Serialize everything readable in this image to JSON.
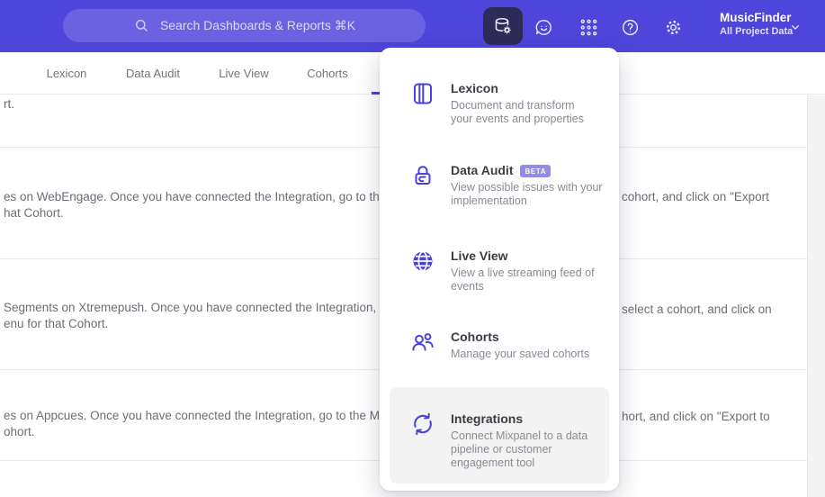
{
  "header": {
    "search_placeholder": "Search Dashboards & Reports ⌘K",
    "project_name": "MusicFinder",
    "project_scope": "All Project Data",
    "icon_names": [
      "data-management-icon",
      "feedback-icon",
      "apps-grid-icon",
      "help-icon",
      "settings-icon",
      "chevron-down-icon"
    ]
  },
  "tabs": {
    "items": [
      {
        "label": "Lexicon"
      },
      {
        "label": "Data Audit"
      },
      {
        "label": "Live View"
      },
      {
        "label": "Cohorts"
      }
    ],
    "active_indicator_color": "#4a40dc"
  },
  "content": {
    "rows": [
      {
        "left_line2": "rt."
      },
      {
        "left_line1": "es on WebEngage. Once you have connected the Integration, go to the",
        "right_line1": "cohort, and click on \"Export",
        "left_line2": "hat Cohort."
      },
      {
        "left_line1": "Segments on Xtremepush. Once you have connected the Integration,",
        "right_line1": "select a cohort, and click on",
        "left_line2": "enu for that Cohort."
      },
      {
        "left_line1": "es on Appcues. Once you have connected the Integration, go to the M",
        "right_line1": "hort, and click on \"Export to",
        "left_line2": "ohort."
      }
    ]
  },
  "menu": {
    "items": [
      {
        "label": "Lexicon",
        "icon": "book-icon",
        "desc_lines": [
          "Document and transform",
          "your events and properties"
        ]
      },
      {
        "label": "Data Audit",
        "badge": "BETA",
        "icon": "lock-icon",
        "desc_lines": [
          "View possible issues with your",
          "implementation"
        ]
      },
      {
        "label": "Live View",
        "icon": "globe-icon",
        "desc_lines": [
          "View a live streaming feed of",
          "events"
        ]
      },
      {
        "label": "Cohorts",
        "icon": "users-icon",
        "desc_lines": [
          "Manage your saved cohorts"
        ]
      },
      {
        "label": "Integrations",
        "icon": "sync-arrows-icon",
        "highlighted": true,
        "desc_lines": [
          "Connect Mixpanel to a data",
          "pipeline or customer",
          "engagement tool"
        ]
      }
    ]
  },
  "colors": {
    "header_bg": "#4e45da",
    "accent": "#4a40dc",
    "active_tile_bg": "#2e2b58",
    "beta_badge_bg": "#948be7",
    "hover_highlight": "#f3f3f4"
  }
}
